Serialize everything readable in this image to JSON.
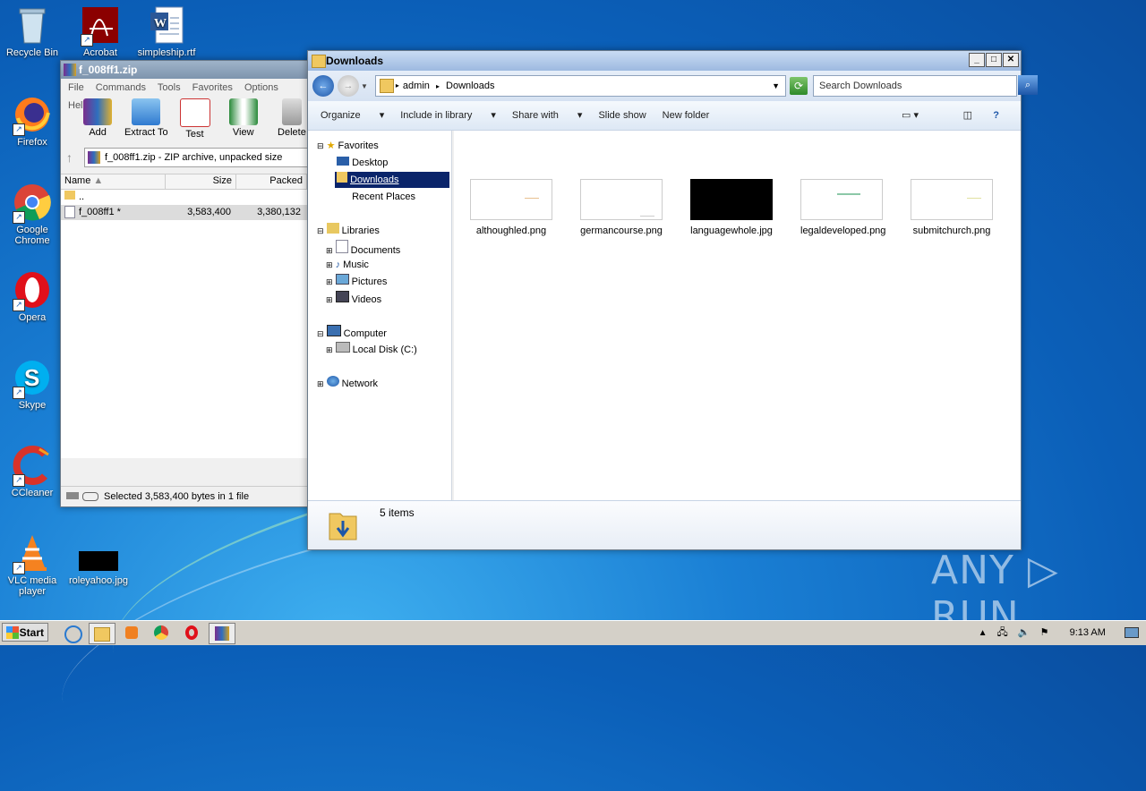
{
  "desktop": {
    "icons": [
      {
        "label": "Recycle Bin",
        "icon": "recycle-bin-icon"
      },
      {
        "label": "Acrobat",
        "icon": "acrobat-icon"
      },
      {
        "label": "simpleship.rtf",
        "icon": "word-document-icon"
      },
      {
        "label": "Firefox",
        "icon": "firefox-icon"
      },
      {
        "label": "Google Chrome",
        "icon": "chrome-icon"
      },
      {
        "label": "Opera",
        "icon": "opera-icon"
      },
      {
        "label": "Skype",
        "icon": "skype-icon"
      },
      {
        "label": "CCleaner",
        "icon": "ccleaner-icon"
      },
      {
        "label": "VLC media player",
        "icon": "vlc-icon"
      },
      {
        "label": "roleyahoo.jpg",
        "icon": "image-file-icon"
      }
    ],
    "watermark": "ANY ▷ RUN"
  },
  "winrar": {
    "title": "f_008ff1.zip",
    "menu": [
      "File",
      "Commands",
      "Tools",
      "Favorites",
      "Options",
      "Help"
    ],
    "toolbar": [
      "Add",
      "Extract To",
      "Test",
      "View",
      "Delete"
    ],
    "address": "f_008ff1.zip - ZIP archive, unpacked size",
    "columns": [
      "Name",
      "Size",
      "Packed"
    ],
    "rows": [
      {
        "name": "..",
        "size": "",
        "packed": ""
      },
      {
        "name": "f_008ff1 *",
        "size": "3,583,400",
        "packed": "3,380,132"
      }
    ],
    "status": "Selected 3,583,400 bytes in 1 file"
  },
  "explorer": {
    "title": "Downloads",
    "breadcrumb": [
      "admin",
      "Downloads"
    ],
    "search_placeholder": "Search Downloads",
    "commands": [
      "Organize",
      "Include in library",
      "Share with",
      "Slide show",
      "New folder"
    ],
    "tree": {
      "favorites": "Favorites",
      "desktop": "Desktop",
      "downloads": "Downloads",
      "recent": "Recent Places",
      "libraries": "Libraries",
      "documents": "Documents",
      "music": "Music",
      "pictures": "Pictures",
      "videos": "Videos",
      "computer": "Computer",
      "local_disk": "Local Disk (C:)",
      "network": "Network"
    },
    "files": [
      {
        "name": "althoughled.png",
        "thumb": "white"
      },
      {
        "name": "germancourse.png",
        "thumb": "white"
      },
      {
        "name": "languagewhole.jpg",
        "thumb": "black"
      },
      {
        "name": "legaldeveloped.png",
        "thumb": "white"
      },
      {
        "name": "submitchurch.png",
        "thumb": "white"
      }
    ],
    "item_count": "5 items"
  },
  "taskbar": {
    "start_label": "Start",
    "clock": "9:13 AM"
  },
  "colors": {
    "selection": "#0a246a",
    "desktop_blue": "#0b5fb8"
  }
}
